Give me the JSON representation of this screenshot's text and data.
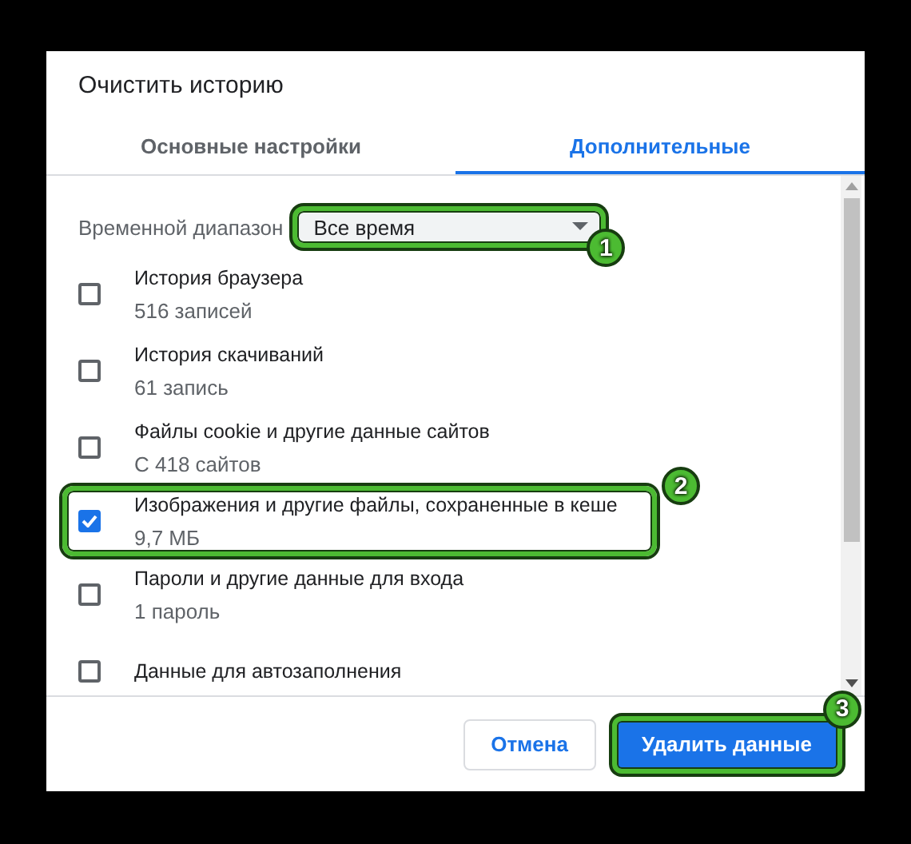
{
  "dialog": {
    "title": "Очистить историю",
    "tabs": [
      {
        "label": "Основные настройки",
        "selected": false
      },
      {
        "label": "Дополнительные",
        "selected": true
      }
    ],
    "time_range": {
      "label": "Временной диапазон",
      "value": "Все время",
      "highlighted": true,
      "callout": "1"
    },
    "items": [
      {
        "title": "История браузера",
        "detail": "516 записей",
        "checked": false,
        "highlighted": false
      },
      {
        "title": "История скачиваний",
        "detail": "61 запись",
        "checked": false,
        "highlighted": false
      },
      {
        "title": "Файлы cookie и другие данные сайтов",
        "detail": "С 418 сайтов",
        "checked": false,
        "highlighted": false
      },
      {
        "title": "Изображения и другие файлы, сохраненные в кеше",
        "detail": "9,7 МБ",
        "checked": true,
        "highlighted": true,
        "callout": "2"
      },
      {
        "title": "Пароли и другие данные для входа",
        "detail": "1 пароль",
        "checked": false,
        "highlighted": false
      },
      {
        "title": "Данные для автозаполнения",
        "checked": false,
        "highlighted": false
      }
    ],
    "buttons": [
      {
        "label": "Отмена",
        "kind": "secondary",
        "highlighted": false
      },
      {
        "label": "Удалить данные",
        "kind": "primary",
        "highlighted": true,
        "callout": "3"
      }
    ]
  }
}
